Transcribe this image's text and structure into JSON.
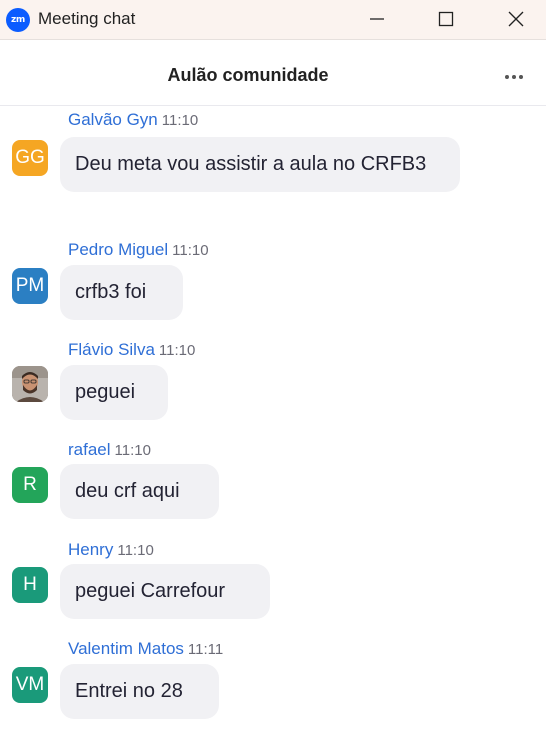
{
  "window": {
    "app_logo_text": "zm",
    "title": "Meeting chat",
    "accent": "#0b5cff"
  },
  "chat": {
    "title": "Aulão comunidade",
    "more_icon": "more-horizontal-icon"
  },
  "messages": [
    {
      "initials": "GG",
      "avatar_color": "#f5a623",
      "name": "Galvão Gyn",
      "time": "11:10",
      "text": "Deu meta vou assistir a aula no CRFB3"
    },
    {
      "initials": "PM",
      "avatar_color": "#2b7fc3",
      "name": "Pedro Miguel",
      "time": "11:10",
      "text": "crfb3 foi"
    },
    {
      "initials": "",
      "avatar_color": "#7a6b62",
      "avatar_photo": true,
      "name": "Flávio Silva",
      "time": "11:10",
      "text": "peguei"
    },
    {
      "initials": "R",
      "avatar_color": "#23a55a",
      "name": "rafael",
      "time": "11:10",
      "text": "deu crf aqui"
    },
    {
      "initials": "H",
      "avatar_color": "#1a9a7a",
      "name": "Henry",
      "time": "11:10",
      "text": "peguei Carrefour"
    },
    {
      "initials": "VM",
      "avatar_color": "#1a9a7a",
      "name": "Valentim Matos",
      "time": "11:11",
      "text": "Entrei no 28"
    }
  ]
}
